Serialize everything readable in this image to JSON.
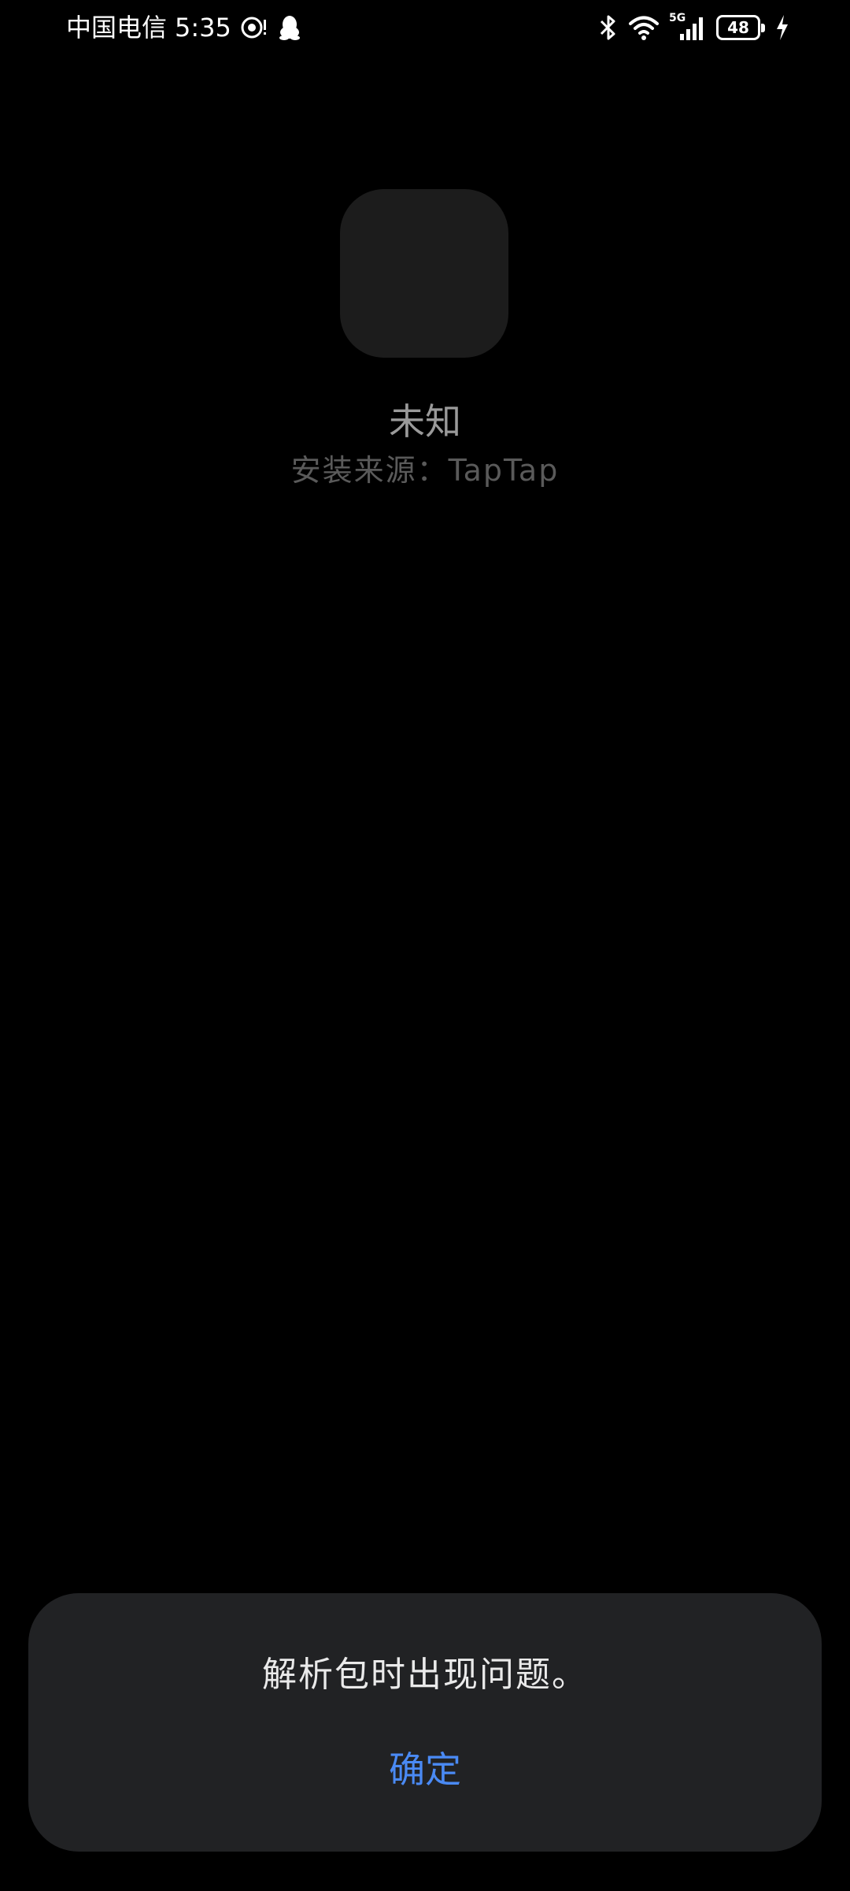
{
  "status_bar": {
    "carrier": "中国电信",
    "time": "5:35",
    "network_label": "5G",
    "battery_level": "48",
    "icons": [
      "location-ring-icon",
      "qq-penguin-icon",
      "bluetooth-icon",
      "wifi-icon",
      "signal-icon",
      "battery-icon",
      "charging-icon"
    ]
  },
  "app": {
    "name": "未知",
    "install_source": "安装来源：TapTap"
  },
  "dialog": {
    "message": "解析包时出现问题。",
    "confirm_label": "确定",
    "confirm_color": "#4a8af4"
  },
  "colors": {
    "background": "#000000",
    "dialog_background": "#212224",
    "app_icon_placeholder": "#1c1c1c"
  }
}
